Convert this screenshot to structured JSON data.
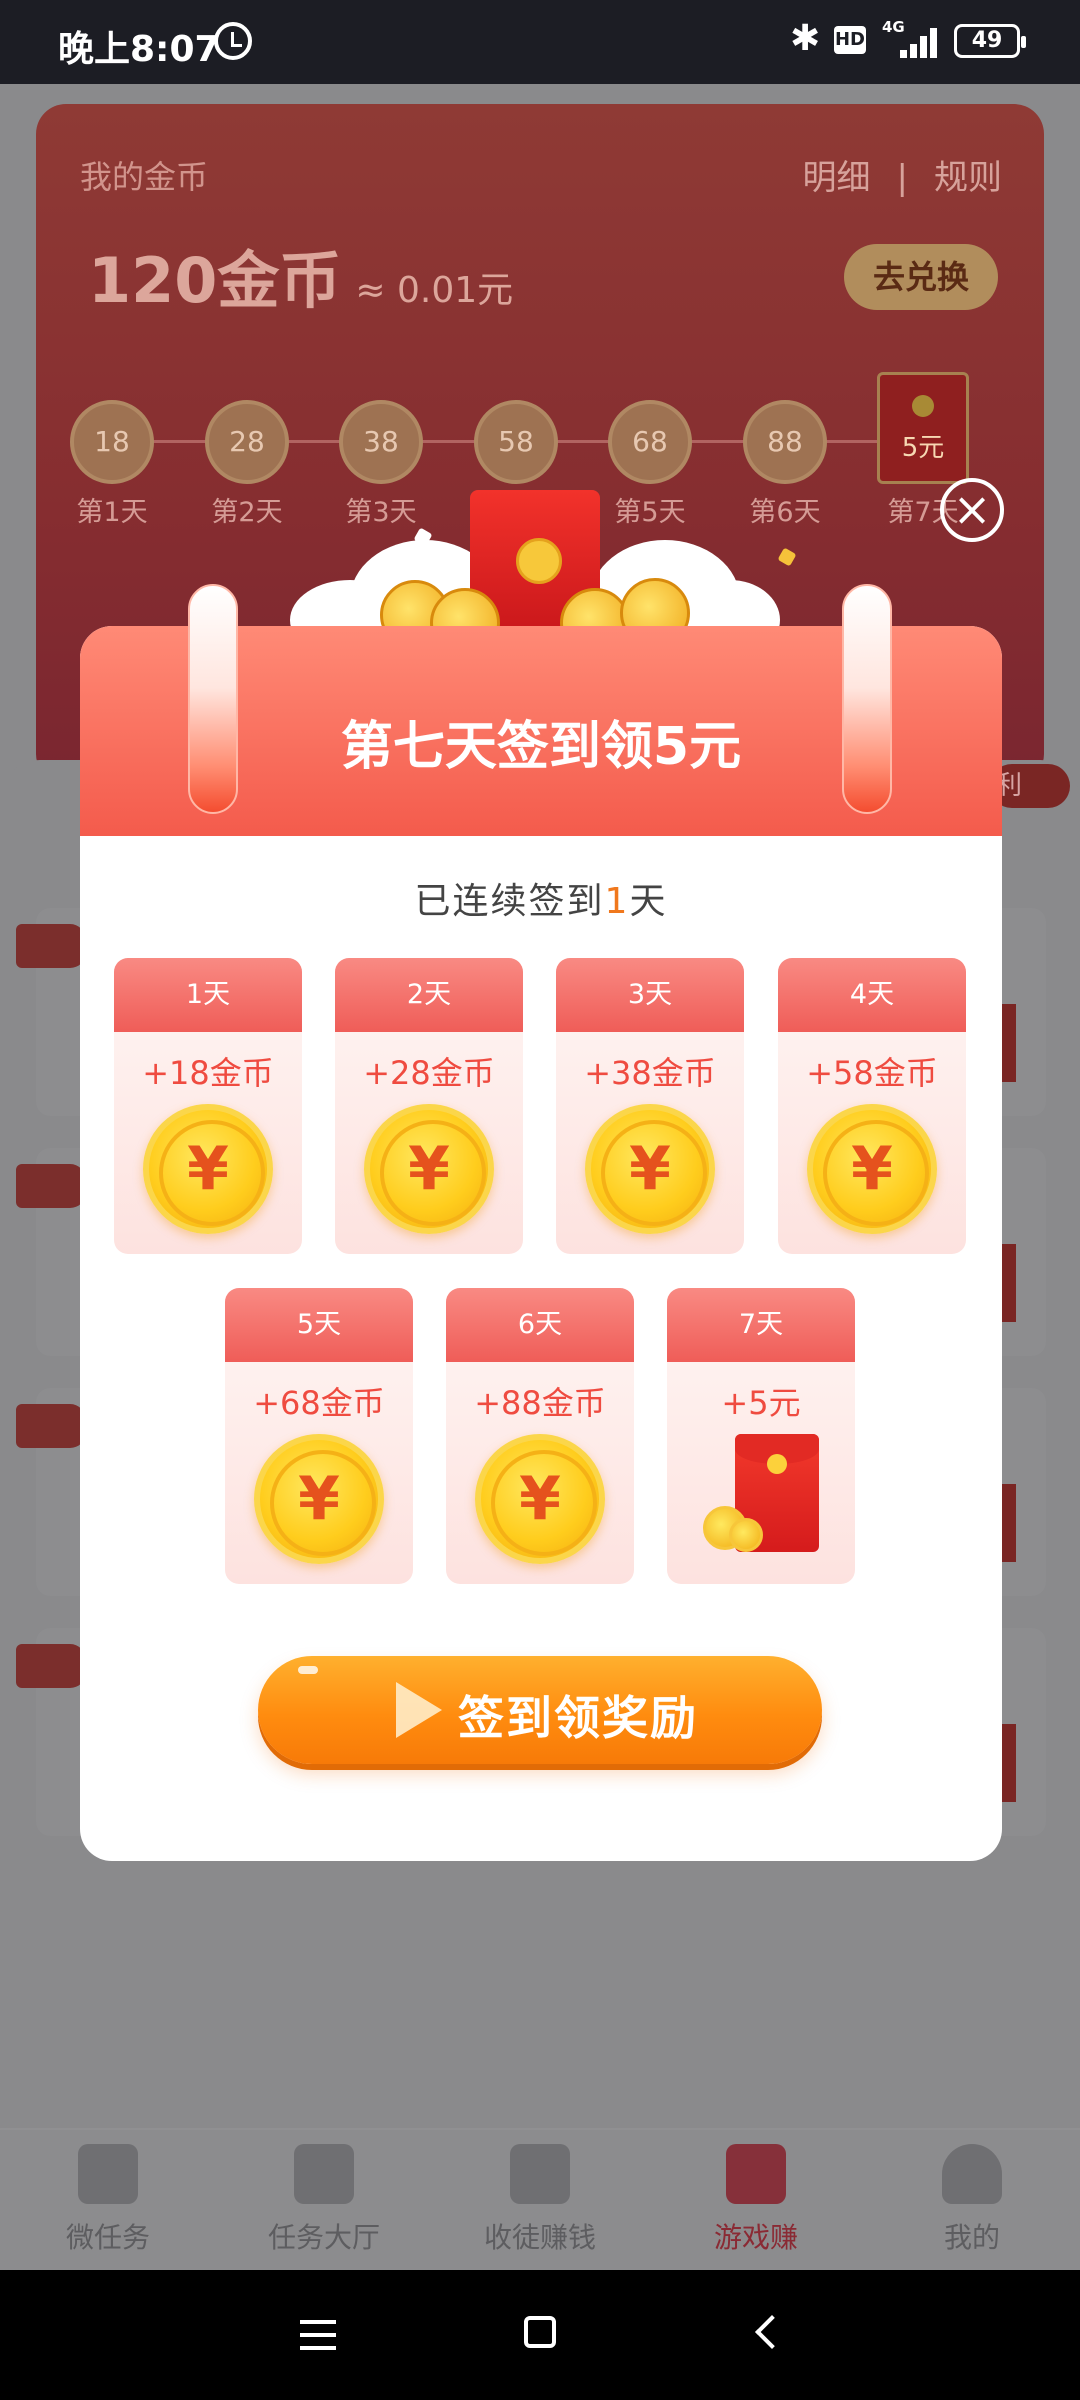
{
  "status_bar": {
    "time": "晚上8:07",
    "network": "4G",
    "hd": "HD",
    "battery": "49"
  },
  "coin_card": {
    "title": "我的金币",
    "link_detail": "明细",
    "link_sep": "|",
    "link_rules": "规则",
    "amount": "120金币",
    "approx": "≈ 0.01元",
    "exchange_label": "去兑换",
    "track": [
      {
        "value": "18",
        "label": "第1天"
      },
      {
        "value": "28",
        "label": "第2天"
      },
      {
        "value": "38",
        "label": "第3天"
      },
      {
        "value": "58",
        "label": ""
      },
      {
        "value": "68",
        "label": "第5天"
      },
      {
        "value": "88",
        "label": "第6天"
      },
      {
        "value": "5元",
        "label": "第7天"
      }
    ],
    "right_badge": "利"
  },
  "modal": {
    "title": "第七天签到领5元",
    "streak_prefix": "已连续签到",
    "streak_count": "1",
    "streak_suffix": "天",
    "coin_symbol": "¥",
    "days": [
      {
        "day": "1天",
        "reward": "+18金币"
      },
      {
        "day": "2天",
        "reward": "+28金币"
      },
      {
        "day": "3天",
        "reward": "+38金币"
      },
      {
        "day": "4天",
        "reward": "+58金币"
      },
      {
        "day": "5天",
        "reward": "+68金币"
      },
      {
        "day": "6天",
        "reward": "+88金币"
      },
      {
        "day": "7天",
        "reward": "+5元"
      }
    ],
    "claim_label": "签到领奖励",
    "close_glyph": "×"
  },
  "bottom_nav": [
    {
      "label": "微任务",
      "icon": "clipboard-check-icon",
      "active": false
    },
    {
      "label": "任务大厅",
      "icon": "grid-icon",
      "active": false
    },
    {
      "label": "收徒赚钱",
      "icon": "envelope-plus-icon",
      "active": false
    },
    {
      "label": "游戏赚",
      "icon": "gamepad-icon",
      "active": true
    },
    {
      "label": "我的",
      "icon": "person-icon",
      "active": false
    }
  ],
  "colors": {
    "accent": "#ef5d58",
    "button": "#ff8c0f",
    "streak_number": "#f0781d"
  }
}
